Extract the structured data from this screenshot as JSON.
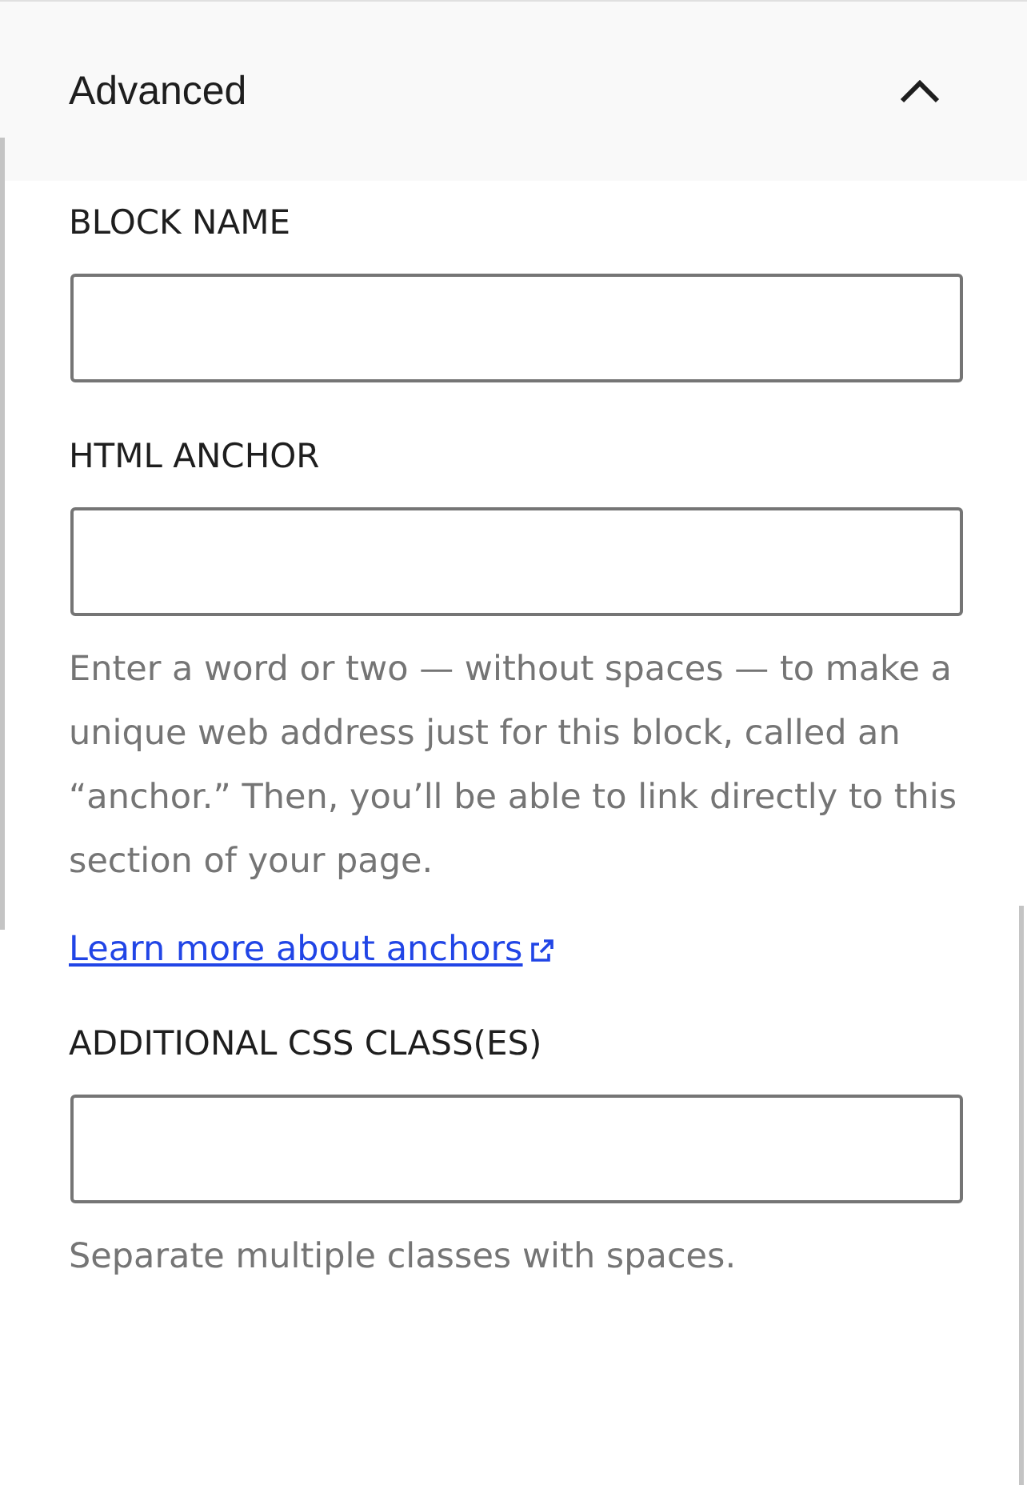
{
  "panel": {
    "title": "Advanced",
    "expanded": true
  },
  "fields": [
    {
      "label": "BLOCK NAME"
    },
    {
      "label": "HTML ANCHOR",
      "help": "Enter a word or two — without spaces — to make a unique web address just for this block, called an “anchor.” Then, you’ll be able to link directly to this section of your page.",
      "link": "Learn more about anchors"
    },
    {
      "label": "ADDITIONAL CSS CLASS(ES)",
      "help": "Separate multiple classes with spaces."
    }
  ]
}
